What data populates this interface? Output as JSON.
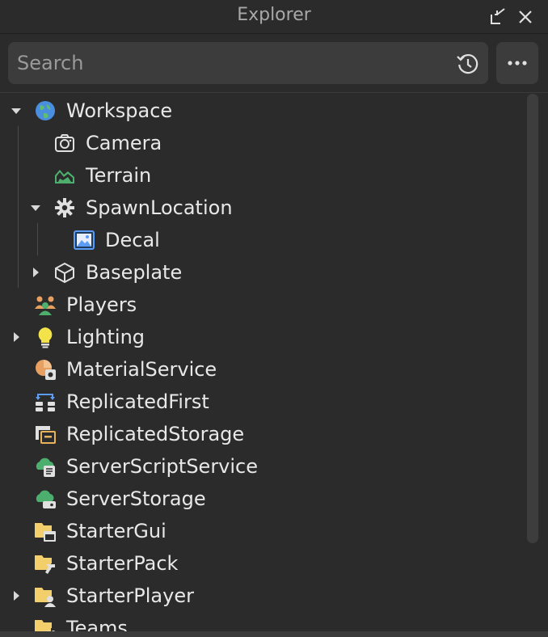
{
  "window": {
    "title": "Explorer"
  },
  "search": {
    "placeholder": "Search"
  },
  "tree": [
    {
      "label": "Workspace",
      "depth": 0,
      "expander": "expanded",
      "icon": "globe-icon"
    },
    {
      "label": "Camera",
      "depth": 1,
      "expander": "none",
      "icon": "camera-icon"
    },
    {
      "label": "Terrain",
      "depth": 1,
      "expander": "none",
      "icon": "terrain-icon"
    },
    {
      "label": "SpawnLocation",
      "depth": 1,
      "expander": "expanded",
      "icon": "spawn-gear-icon"
    },
    {
      "label": "Decal",
      "depth": 2,
      "expander": "none",
      "icon": "decal-image-icon"
    },
    {
      "label": "Baseplate",
      "depth": 1,
      "expander": "collapsed",
      "icon": "part-cube-icon"
    },
    {
      "label": "Players",
      "depth": 0,
      "expander": "none",
      "icon": "players-icon"
    },
    {
      "label": "Lighting",
      "depth": 0,
      "expander": "collapsed",
      "icon": "lightbulb-icon"
    },
    {
      "label": "MaterialService",
      "depth": 0,
      "expander": "none",
      "icon": "material-service-icon"
    },
    {
      "label": "ReplicatedFirst",
      "depth": 0,
      "expander": "none",
      "icon": "replicated-first-icon"
    },
    {
      "label": "ReplicatedStorage",
      "depth": 0,
      "expander": "none",
      "icon": "replicated-storage-icon"
    },
    {
      "label": "ServerScriptService",
      "depth": 0,
      "expander": "none",
      "icon": "server-script-service-icon"
    },
    {
      "label": "ServerStorage",
      "depth": 0,
      "expander": "none",
      "icon": "server-storage-icon"
    },
    {
      "label": "StarterGui",
      "depth": 0,
      "expander": "none",
      "icon": "starter-gui-icon"
    },
    {
      "label": "StarterPack",
      "depth": 0,
      "expander": "none",
      "icon": "starter-pack-icon"
    },
    {
      "label": "StarterPlayer",
      "depth": 0,
      "expander": "collapsed",
      "icon": "starter-player-icon"
    },
    {
      "label": "Teams",
      "depth": 0,
      "expander": "none",
      "icon": "teams-icon"
    }
  ],
  "colors": {
    "background": "#2b2b2b",
    "input_bg": "#3c3c3c",
    "text": "#e8e8e8",
    "folder_yellow": "#f2cf6b",
    "green": "#4caf6e",
    "blue": "#5b9cf5",
    "orange": "#e8a060"
  }
}
